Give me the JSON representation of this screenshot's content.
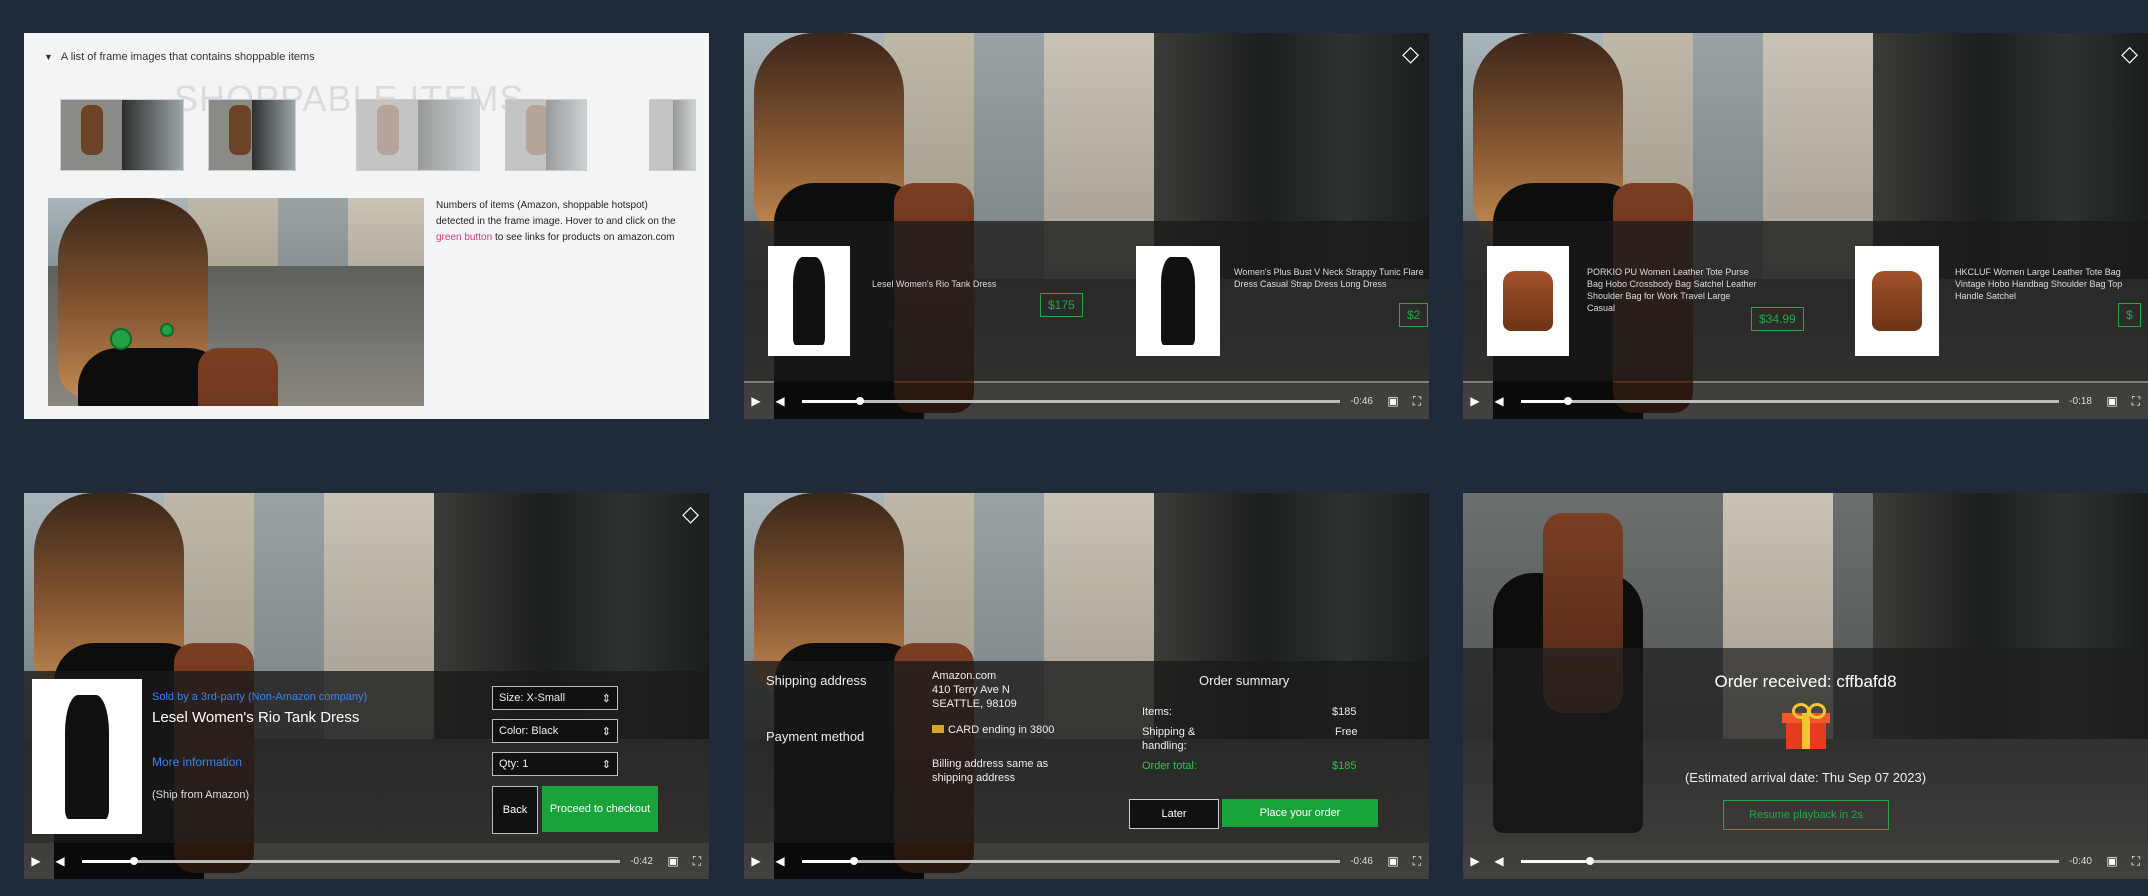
{
  "panel1": {
    "header": "A list of frame images that contains shoppable items",
    "watermark": "SHOPPABLE ITEMS",
    "desc_before": "Numbers of items (Amazon, shoppable hotspot) detected in the frame image. Hover to and click on the ",
    "desc_link": "green button",
    "desc_after": " to see links for products on amazon.com"
  },
  "panel2": {
    "product1_title": "Lesel Women's Rio Tank Dress",
    "product1_price": "$175",
    "product2_title": "Women's Plus Bust V Neck Strappy Tunic Flare Dress Casual Strap Dress Long Dress",
    "product2_price": "$2"
  },
  "panel3": {
    "product1_title": "PORKIO PU Women Leather Tote Purse Bag Hobo Crossbody Bag Satchel Leather Shoulder Bag for Work Travel Large Casual",
    "product1_price": "$34.99",
    "product2_title": "HKCLUF Women Large Leather Tote Bag Vintage Hobo Handbag Shoulder Bag Top Handle Satchel",
    "product2_price": "$"
  },
  "panel4": {
    "seller": "Sold by a 3rd-party (Non-Amazon company)",
    "title": "Lesel Women's Rio Tank Dress",
    "more_info": "More information",
    "ship": "(Ship from Amazon)",
    "size": "Size: X-Small",
    "color": "Color: Black",
    "qty": "Qty: 1",
    "back": "Back",
    "checkout": "Proceed to checkout"
  },
  "panel5": {
    "shipping_label": "Shipping address",
    "shipping_value": "Amazon.com\n410 Terry Ave N\nSEATTLE, 98109",
    "payment_label": "Payment method",
    "payment_value": "CARD ending in 3800",
    "billing": "Billing address same as shipping address",
    "summary_title": "Order summary",
    "items_label": "Items:",
    "items_value": "$185",
    "shipping_fee_label": "Shipping & handling:",
    "shipping_fee_value": "Free",
    "total_label": "Order total:",
    "total_value": "$185",
    "later": "Later",
    "place_order": "Place your order"
  },
  "panel6": {
    "received": "Order received: cffbafd8",
    "estimated": "(Estimated arrival date: Thu Sep 07 2023)",
    "resume": "Resume playback in 2s"
  },
  "controls": {
    "time_a": "-0:46",
    "time_b": "-0:18",
    "time_c": "-0:42",
    "time_d": "-0:46",
    "time_e": "-0:46",
    "time_f": "-0:40"
  },
  "colors": {
    "accent_green": "#1aa33b",
    "link_blue": "#3b82f6",
    "page_bg": "#1f2a3a"
  }
}
